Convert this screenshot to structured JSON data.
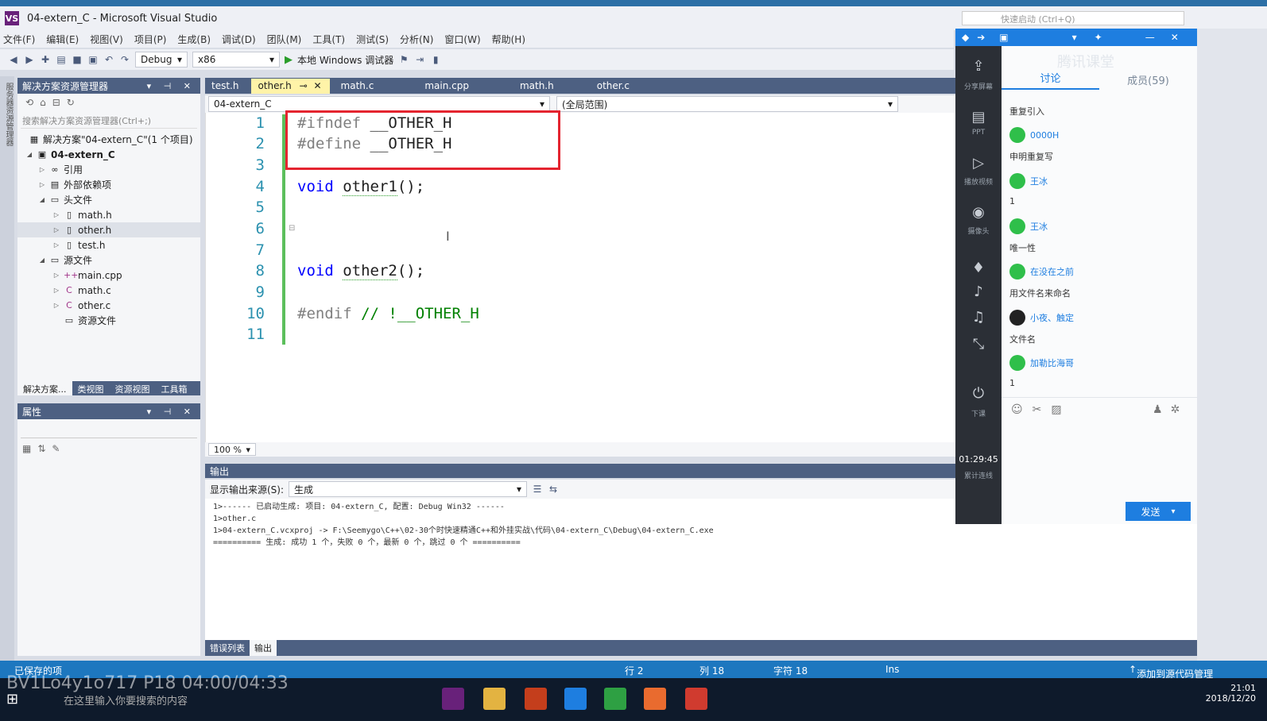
{
  "window": {
    "title": "04-extern_C - Microsoft Visual Studio",
    "logo": "VS"
  },
  "menu": [
    "文件(F)",
    "编辑(E)",
    "视图(V)",
    "项目(P)",
    "生成(B)",
    "调试(D)",
    "团队(M)",
    "工具(T)",
    "测试(S)",
    "分析(N)",
    "窗口(W)",
    "帮助(H)"
  ],
  "toolbar": {
    "config": "Debug",
    "platform": "x86",
    "run_label": "本地 Windows 调试器",
    "quick_launch": "快速启动 (Ctrl+Q)"
  },
  "solution_explorer": {
    "title": "解决方案资源管理器",
    "search_placeholder": "搜索解决方案资源管理器(Ctrl+;)",
    "solution_label": "解决方案\"04-extern_C\"(1 个项目)",
    "project": "04-extern_C",
    "items": {
      "refs": "引用",
      "ext": "外部依赖项",
      "headers": "头文件",
      "math_h": "math.h",
      "other_h": "other.h",
      "test_h": "test.h",
      "sources": "源文件",
      "main_cpp": "main.cpp",
      "math_c": "math.c",
      "other_c": "other.c",
      "resources": "资源文件"
    },
    "bottom_tabs": [
      "解决方案...",
      "类视图",
      "资源视图",
      "工具箱"
    ]
  },
  "properties": {
    "title": "属性"
  },
  "editor": {
    "tabs": [
      "test.h",
      "other.h",
      "math.c",
      "main.cpp",
      "math.h",
      "other.c"
    ],
    "active_tab": "other.h",
    "nav_project": "04-extern_C",
    "nav_scope": "(全局范围)",
    "zoom": "100 %",
    "line_numbers": [
      "1",
      "2",
      "3",
      "4",
      "5",
      "6",
      "7",
      "8",
      "9",
      "10",
      "11"
    ],
    "lines": {
      "l1_dir": "#ifndef",
      "l1_sym": "__OTHER_H",
      "l2_dir": "#define",
      "l2_sym": "__OTHER_H",
      "l4_kw": "void",
      "l4_fn": "other1",
      "l4_rest": "();",
      "l8_kw": "void",
      "l8_fn": "other2",
      "l8_rest": "();",
      "l10_dir": "#endif",
      "l10_cm": "// !__OTHER_H"
    }
  },
  "output": {
    "title": "输出",
    "source_label": "显示输出来源(S):",
    "source_value": "生成",
    "lines": [
      "1>------ 已启动生成: 项目: 04-extern_C, 配置: Debug Win32 ------",
      "1>other.c",
      "1>04-extern_C.vcxproj -> F:\\Seemygo\\C++\\02-30个时快速精通C++和外挂实战\\代码\\04-extern_C\\Debug\\04-extern_C.exe",
      "========== 生成: 成功 1 个，失败 0 个，最新 0 个，跳过 0 个 =========="
    ],
    "tabs": [
      "错误列表",
      "输出"
    ]
  },
  "statusbar": {
    "left": "已保存的项",
    "row": "行 2",
    "col": "列 18",
    "char": "字符 18",
    "mode": "Ins",
    "right": "添加到源代码管理"
  },
  "watermark": "BV1Lo4y1o717 P18 04:00/04:33",
  "taskbar": {
    "search": "在这里输入你要搜索的内容",
    "time": "21:01",
    "date": "2018/12/20"
  },
  "classroom": {
    "tab_discuss": "讨论",
    "tab_members": "成员(59)",
    "brand": "腾讯课堂",
    "side_labels": {
      "share": "分享屏幕",
      "ppt": "PPT",
      "video": "播放视频",
      "camera": "摄像头",
      "end": "下课"
    },
    "timer": "01:29:45",
    "timer_label": "累计连线",
    "messages": [
      {
        "name": "",
        "text": "重复引入"
      },
      {
        "name": "0000H",
        "text": "申明重复写"
      },
      {
        "name": "王冰",
        "text": "1"
      },
      {
        "name": "王冰",
        "text": "唯一性"
      },
      {
        "name": "在没在之前",
        "text": "用文件名来命名"
      },
      {
        "name": "小夜、触定",
        "text": "文件名"
      },
      {
        "name": "加勒比海哥",
        "text": "1"
      }
    ],
    "send": "发送"
  },
  "colors": {
    "accent": "#1e7ee0",
    "vs_blue": "#4d6082",
    "highlight": "#e4242f",
    "status": "#1d77bf"
  }
}
